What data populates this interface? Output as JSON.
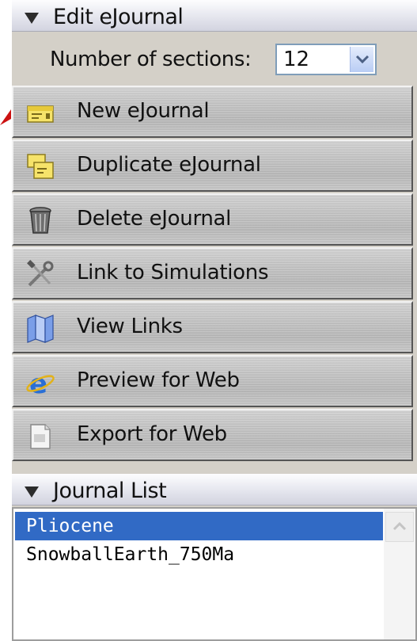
{
  "edit_panel": {
    "title": "Edit eJournal",
    "sections_label": "Number of sections:",
    "sections_value": "12",
    "actions": [
      {
        "label": "New eJournal",
        "icon": "new-journal-icon"
      },
      {
        "label": "Duplicate eJournal",
        "icon": "duplicate-icon"
      },
      {
        "label": "Delete eJournal",
        "icon": "trash-icon"
      },
      {
        "label": "Link to Simulations",
        "icon": "tools-icon"
      },
      {
        "label": "View Links",
        "icon": "view-links-icon"
      },
      {
        "label": "Preview for Web",
        "icon": "internet-explorer-icon"
      },
      {
        "label": "Export for Web",
        "icon": "export-icon"
      }
    ]
  },
  "journal_list": {
    "title": "Journal List",
    "items": [
      "Pliocene",
      "SnowballEarth_750Ma"
    ],
    "selected": "Pliocene"
  },
  "colors": {
    "selection": "#316ac5",
    "panel_bg": "#d4d0c8",
    "arrow": "#cc1111"
  }
}
